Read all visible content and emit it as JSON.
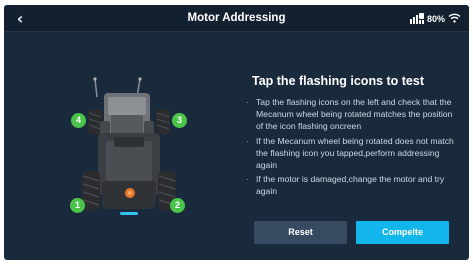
{
  "header": {
    "title": "Motor Addressing",
    "battery_text": "80%"
  },
  "icons": {
    "back": "chevron-left-icon",
    "signal": "robot-signal-icon",
    "wifi": "wifi-icon"
  },
  "robot": {
    "wheel_badges": [
      "1",
      "2",
      "3",
      "4"
    ]
  },
  "panel": {
    "title": "Tap the flashing icons to test",
    "bullet_glyph": "·",
    "instructions": [
      "Tap the flashing icons on the left and check that the Mecanum wheel being rotated matches the position of the icon flashing oncreen",
      "If the Mecanum wheel being rotated does not match the flashing icon you tapped,perform addressing again",
      "If the motor is damaged,change the motor and try again"
    ]
  },
  "buttons": {
    "reset_label": "Reset",
    "complete_label": "Compelte"
  },
  "colors": {
    "background": "#1a2a3d",
    "topbar": "#13202f",
    "badge_green": "#4cc44a",
    "accent_blue": "#13b6ea",
    "reset_button": "#364a62"
  }
}
